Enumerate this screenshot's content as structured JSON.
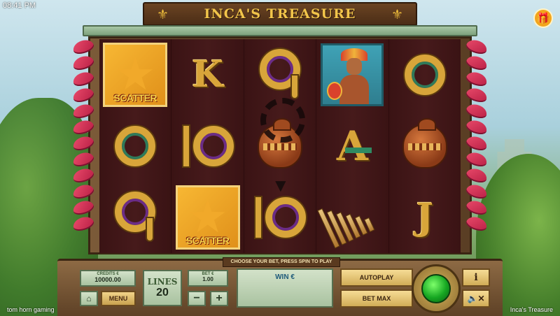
{
  "status": {
    "time": "08:41 PM"
  },
  "title": {
    "text": "INCA'S TREASURE"
  },
  "message": "CHOOSE YOUR BET, PRESS SPIN TO PLAY",
  "reels": [
    [
      {
        "type": "scatter",
        "label": "SCATTER"
      },
      {
        "type": "ring",
        "label": "Q",
        "variant": "green"
      },
      {
        "type": "nine",
        "label": "9"
      }
    ],
    [
      {
        "type": "letter",
        "label": "K"
      },
      {
        "type": "ten",
        "label": "10"
      },
      {
        "type": "scatter",
        "label": "SCATTER"
      }
    ],
    [
      {
        "type": "nine",
        "label": "9"
      },
      {
        "type": "pot",
        "label": ""
      },
      {
        "type": "ten",
        "label": "10"
      }
    ],
    [
      {
        "type": "warrior",
        "label": ""
      },
      {
        "type": "letterA",
        "label": "A"
      },
      {
        "type": "pipes",
        "label": ""
      }
    ],
    [
      {
        "type": "ring",
        "label": "Q",
        "variant": "green"
      },
      {
        "type": "pot",
        "label": ""
      },
      {
        "type": "letter",
        "label": "J"
      }
    ]
  ],
  "controls": {
    "credits_label": "CREDITS €",
    "credits_value": "10000.00",
    "menu_label": "MENU",
    "lines_label": "LINES",
    "lines_value": "20",
    "bet_label": "BET €",
    "bet_value": "1.00",
    "minus_label": "−",
    "plus_label": "+",
    "win_label": "WIN €",
    "autoplay_label": "AUTOPLAY",
    "betmax_label": "BET MAX",
    "info_label": "i",
    "home_icon": "⌂",
    "sound_icon": "🔈✕"
  },
  "footer": {
    "brand": "tom horn gaming",
    "game": "Inca's Treasure"
  },
  "colors": {
    "spin": "#16a722",
    "gold": "#d8a53a",
    "reel_bg": "#3f1617"
  }
}
